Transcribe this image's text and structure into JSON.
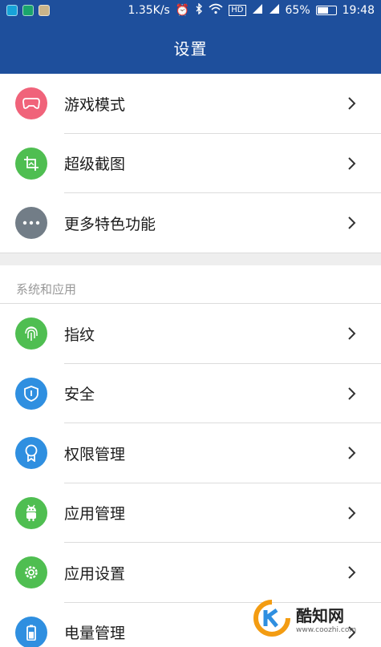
{
  "status_bar": {
    "speed": "1.35K/s",
    "hd": "HD",
    "battery_percent": "65%",
    "battery_level": 0.65,
    "time": "19:48",
    "app_icons": [
      "app-icon-1",
      "app-icon-2",
      "app-icon-3"
    ],
    "icons": [
      "alarm-icon",
      "bluetooth-icon",
      "wifi-icon",
      "signal-icon",
      "battery-icon"
    ]
  },
  "header": {
    "title": "设置"
  },
  "top_items": [
    {
      "label": "游戏模式",
      "icon": "gamepad-icon",
      "color": "#f0637a"
    },
    {
      "label": "超级截图",
      "icon": "screenshot-icon",
      "color": "#4fbe51"
    },
    {
      "label": "更多特色功能",
      "icon": "more-icon",
      "color": "#727d87"
    }
  ],
  "section": {
    "title": "系统和应用"
  },
  "system_items": [
    {
      "label": "指纹",
      "icon": "fingerprint-icon",
      "color": "#4fbe51"
    },
    {
      "label": "安全",
      "icon": "shield-icon",
      "color": "#2f8fe0"
    },
    {
      "label": "权限管理",
      "icon": "badge-icon",
      "color": "#2f8fe0"
    },
    {
      "label": "应用管理",
      "icon": "android-icon",
      "color": "#4fbe51"
    },
    {
      "label": "应用设置",
      "icon": "gear-icon",
      "color": "#4fbe51"
    },
    {
      "label": "电量管理",
      "icon": "battery-icon",
      "color": "#2f8fe0"
    }
  ],
  "watermark": {
    "text": "酷知网",
    "url": "www.coozhi.com"
  }
}
